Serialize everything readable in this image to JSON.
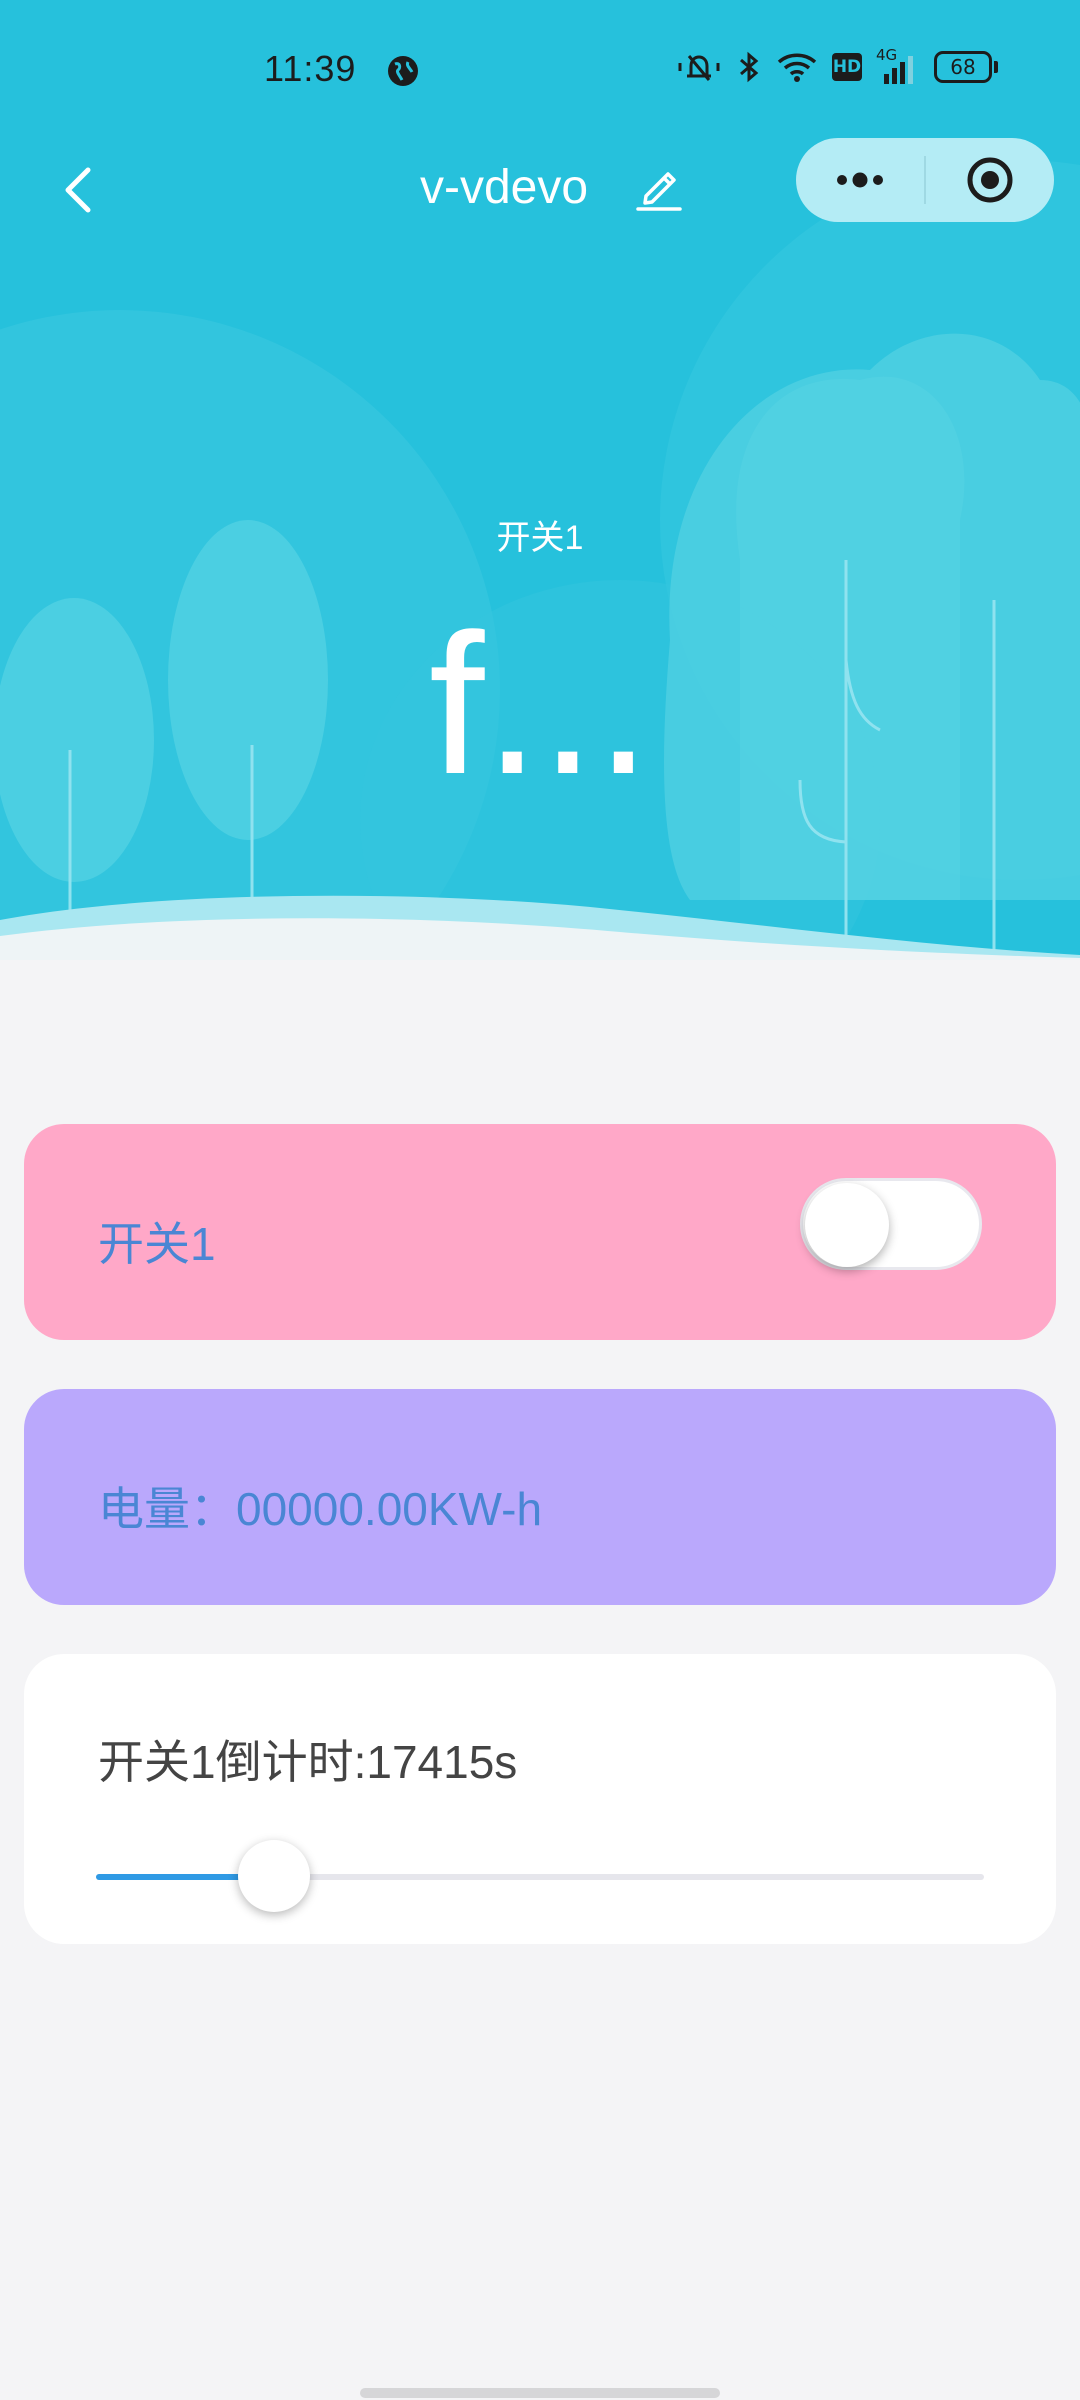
{
  "status_bar": {
    "time": "11:39",
    "network": "4G",
    "hd_badge": "HD",
    "battery": "68"
  },
  "nav": {
    "title": "v-vdevo"
  },
  "hero": {
    "label": "开关1",
    "value": "f..."
  },
  "switch_card": {
    "label": "开关1",
    "switch_on": false
  },
  "energy_card": {
    "text": "电量：00000.00KW-h"
  },
  "timer_card": {
    "label": "开关1倒计时:17415s",
    "slider_fraction": 0.2
  },
  "colors": {
    "header": "#26c1dc",
    "switch_card": "#ffa8c8",
    "energy_card": "#baa8fc",
    "accent_text": "#4a86d4",
    "slider_fill": "#2f9ae5"
  },
  "icons": [
    "globe-icon",
    "mute-icon",
    "bluetooth-icon",
    "wifi-icon",
    "signal-icon",
    "battery-icon",
    "back-icon",
    "edit-icon",
    "more-icon",
    "close-target-icon"
  ]
}
